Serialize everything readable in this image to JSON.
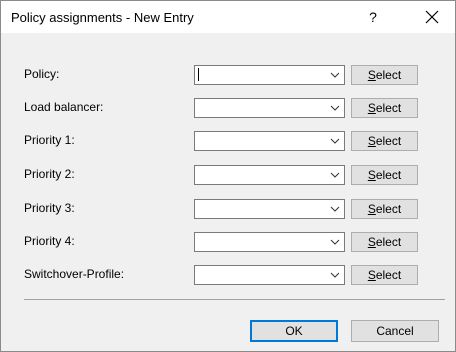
{
  "dialog": {
    "title": "Policy assignments - New Entry",
    "help_label": "?"
  },
  "rows": [
    {
      "label": "Policy:",
      "value": "",
      "select_prefix": "S",
      "select_rest": "elect"
    },
    {
      "label": "Load balancer:",
      "value": "",
      "select_prefix": "S",
      "select_rest": "elect"
    },
    {
      "label": "Priority 1:",
      "value": "",
      "select_prefix": "S",
      "select_rest": "elect"
    },
    {
      "label": "Priority 2:",
      "value": "",
      "select_prefix": "S",
      "select_rest": "elect"
    },
    {
      "label": "Priority 3:",
      "value": "",
      "select_prefix": "S",
      "select_rest": "elect"
    },
    {
      "label": "Priority 4:",
      "value": "",
      "select_prefix": "S",
      "select_rest": "elect"
    },
    {
      "label": "Switchover-Profile:",
      "value": "",
      "select_prefix": "S",
      "select_rest": "elect"
    }
  ],
  "footer": {
    "ok_label": "OK",
    "cancel_label": "Cancel"
  },
  "colors": {
    "focus_border": "#0078d7",
    "button_bg": "#e1e1e1",
    "dialog_bg": "#f0f0f0"
  }
}
